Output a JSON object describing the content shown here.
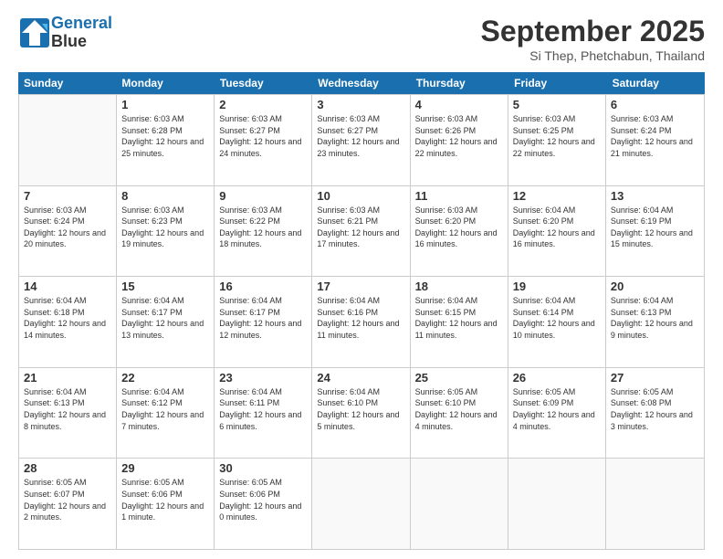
{
  "logo": {
    "line1": "General",
    "line2": "Blue"
  },
  "title": "September 2025",
  "subtitle": "Si Thep, Phetchabun, Thailand",
  "header_days": [
    "Sunday",
    "Monday",
    "Tuesday",
    "Wednesday",
    "Thursday",
    "Friday",
    "Saturday"
  ],
  "rows": [
    [
      {
        "day": "",
        "sunrise": "",
        "sunset": "",
        "daylight": ""
      },
      {
        "day": "1",
        "sunrise": "Sunrise: 6:03 AM",
        "sunset": "Sunset: 6:28 PM",
        "daylight": "Daylight: 12 hours and 25 minutes."
      },
      {
        "day": "2",
        "sunrise": "Sunrise: 6:03 AM",
        "sunset": "Sunset: 6:27 PM",
        "daylight": "Daylight: 12 hours and 24 minutes."
      },
      {
        "day": "3",
        "sunrise": "Sunrise: 6:03 AM",
        "sunset": "Sunset: 6:27 PM",
        "daylight": "Daylight: 12 hours and 23 minutes."
      },
      {
        "day": "4",
        "sunrise": "Sunrise: 6:03 AM",
        "sunset": "Sunset: 6:26 PM",
        "daylight": "Daylight: 12 hours and 22 minutes."
      },
      {
        "day": "5",
        "sunrise": "Sunrise: 6:03 AM",
        "sunset": "Sunset: 6:25 PM",
        "daylight": "Daylight: 12 hours and 22 minutes."
      },
      {
        "day": "6",
        "sunrise": "Sunrise: 6:03 AM",
        "sunset": "Sunset: 6:24 PM",
        "daylight": "Daylight: 12 hours and 21 minutes."
      }
    ],
    [
      {
        "day": "7",
        "sunrise": "Sunrise: 6:03 AM",
        "sunset": "Sunset: 6:24 PM",
        "daylight": "Daylight: 12 hours and 20 minutes."
      },
      {
        "day": "8",
        "sunrise": "Sunrise: 6:03 AM",
        "sunset": "Sunset: 6:23 PM",
        "daylight": "Daylight: 12 hours and 19 minutes."
      },
      {
        "day": "9",
        "sunrise": "Sunrise: 6:03 AM",
        "sunset": "Sunset: 6:22 PM",
        "daylight": "Daylight: 12 hours and 18 minutes."
      },
      {
        "day": "10",
        "sunrise": "Sunrise: 6:03 AM",
        "sunset": "Sunset: 6:21 PM",
        "daylight": "Daylight: 12 hours and 17 minutes."
      },
      {
        "day": "11",
        "sunrise": "Sunrise: 6:03 AM",
        "sunset": "Sunset: 6:20 PM",
        "daylight": "Daylight: 12 hours and 16 minutes."
      },
      {
        "day": "12",
        "sunrise": "Sunrise: 6:04 AM",
        "sunset": "Sunset: 6:20 PM",
        "daylight": "Daylight: 12 hours and 16 minutes."
      },
      {
        "day": "13",
        "sunrise": "Sunrise: 6:04 AM",
        "sunset": "Sunset: 6:19 PM",
        "daylight": "Daylight: 12 hours and 15 minutes."
      }
    ],
    [
      {
        "day": "14",
        "sunrise": "Sunrise: 6:04 AM",
        "sunset": "Sunset: 6:18 PM",
        "daylight": "Daylight: 12 hours and 14 minutes."
      },
      {
        "day": "15",
        "sunrise": "Sunrise: 6:04 AM",
        "sunset": "Sunset: 6:17 PM",
        "daylight": "Daylight: 12 hours and 13 minutes."
      },
      {
        "day": "16",
        "sunrise": "Sunrise: 6:04 AM",
        "sunset": "Sunset: 6:17 PM",
        "daylight": "Daylight: 12 hours and 12 minutes."
      },
      {
        "day": "17",
        "sunrise": "Sunrise: 6:04 AM",
        "sunset": "Sunset: 6:16 PM",
        "daylight": "Daylight: 12 hours and 11 minutes."
      },
      {
        "day": "18",
        "sunrise": "Sunrise: 6:04 AM",
        "sunset": "Sunset: 6:15 PM",
        "daylight": "Daylight: 12 hours and 11 minutes."
      },
      {
        "day": "19",
        "sunrise": "Sunrise: 6:04 AM",
        "sunset": "Sunset: 6:14 PM",
        "daylight": "Daylight: 12 hours and 10 minutes."
      },
      {
        "day": "20",
        "sunrise": "Sunrise: 6:04 AM",
        "sunset": "Sunset: 6:13 PM",
        "daylight": "Daylight: 12 hours and 9 minutes."
      }
    ],
    [
      {
        "day": "21",
        "sunrise": "Sunrise: 6:04 AM",
        "sunset": "Sunset: 6:13 PM",
        "daylight": "Daylight: 12 hours and 8 minutes."
      },
      {
        "day": "22",
        "sunrise": "Sunrise: 6:04 AM",
        "sunset": "Sunset: 6:12 PM",
        "daylight": "Daylight: 12 hours and 7 minutes."
      },
      {
        "day": "23",
        "sunrise": "Sunrise: 6:04 AM",
        "sunset": "Sunset: 6:11 PM",
        "daylight": "Daylight: 12 hours and 6 minutes."
      },
      {
        "day": "24",
        "sunrise": "Sunrise: 6:04 AM",
        "sunset": "Sunset: 6:10 PM",
        "daylight": "Daylight: 12 hours and 5 minutes."
      },
      {
        "day": "25",
        "sunrise": "Sunrise: 6:05 AM",
        "sunset": "Sunset: 6:10 PM",
        "daylight": "Daylight: 12 hours and 4 minutes."
      },
      {
        "day": "26",
        "sunrise": "Sunrise: 6:05 AM",
        "sunset": "Sunset: 6:09 PM",
        "daylight": "Daylight: 12 hours and 4 minutes."
      },
      {
        "day": "27",
        "sunrise": "Sunrise: 6:05 AM",
        "sunset": "Sunset: 6:08 PM",
        "daylight": "Daylight: 12 hours and 3 minutes."
      }
    ],
    [
      {
        "day": "28",
        "sunrise": "Sunrise: 6:05 AM",
        "sunset": "Sunset: 6:07 PM",
        "daylight": "Daylight: 12 hours and 2 minutes."
      },
      {
        "day": "29",
        "sunrise": "Sunrise: 6:05 AM",
        "sunset": "Sunset: 6:06 PM",
        "daylight": "Daylight: 12 hours and 1 minute."
      },
      {
        "day": "30",
        "sunrise": "Sunrise: 6:05 AM",
        "sunset": "Sunset: 6:06 PM",
        "daylight": "Daylight: 12 hours and 0 minutes."
      },
      {
        "day": "",
        "sunrise": "",
        "sunset": "",
        "daylight": ""
      },
      {
        "day": "",
        "sunrise": "",
        "sunset": "",
        "daylight": ""
      },
      {
        "day": "",
        "sunrise": "",
        "sunset": "",
        "daylight": ""
      },
      {
        "day": "",
        "sunrise": "",
        "sunset": "",
        "daylight": ""
      }
    ]
  ]
}
